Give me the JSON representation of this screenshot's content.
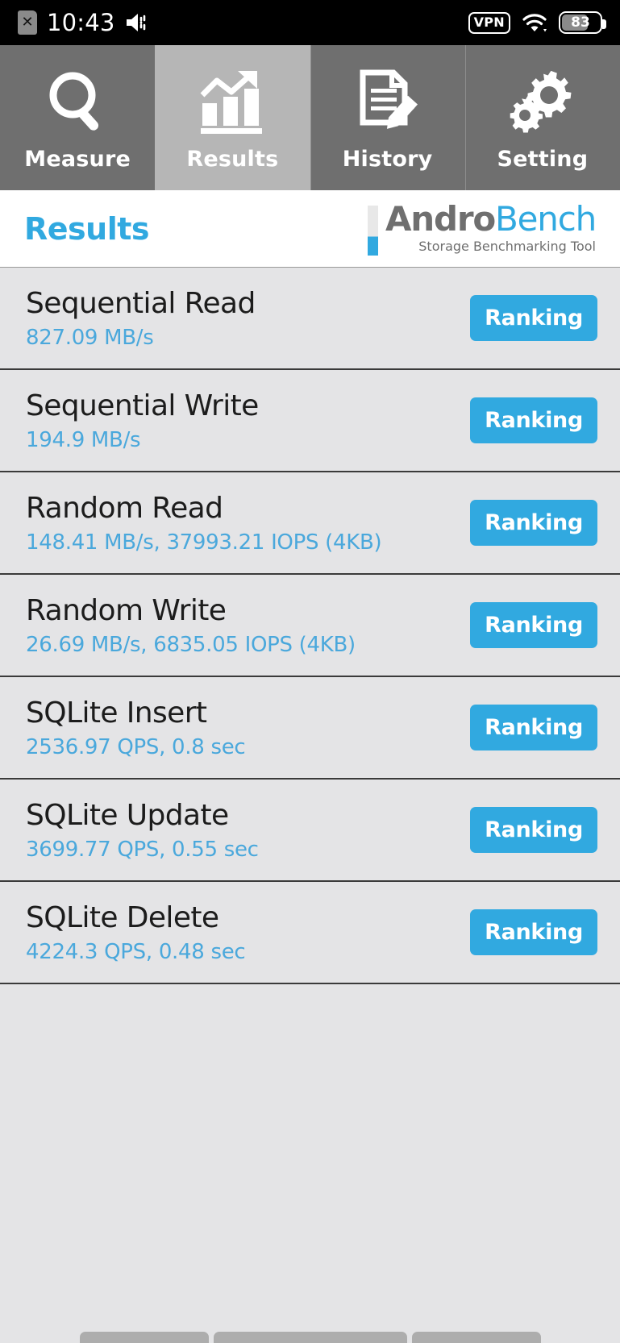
{
  "statusbar": {
    "sim_icon": "sim-card-off-icon",
    "time": "10:43",
    "volume_icon": "volume-icon",
    "vpn_label": "VPN",
    "wifi_icon": "wifi-icon",
    "battery_level": "83"
  },
  "tabs": [
    {
      "label": "Measure",
      "icon": "magnifier-icon",
      "active": false
    },
    {
      "label": "Results",
      "icon": "bar-chart-arrow-icon",
      "active": true
    },
    {
      "label": "History",
      "icon": "document-pencil-icon",
      "active": false
    },
    {
      "label": "Setting",
      "icon": "gears-icon",
      "active": false
    }
  ],
  "header": {
    "page_title": "Results",
    "brand_first": "Andro",
    "brand_second": "Bench",
    "brand_subtitle": "Storage Benchmarking Tool"
  },
  "results": [
    {
      "title": "Sequential Read",
      "value": "827.09 MB/s",
      "button": "Ranking"
    },
    {
      "title": "Sequential Write",
      "value": "194.9 MB/s",
      "button": "Ranking"
    },
    {
      "title": "Random Read",
      "value": "148.41 MB/s, 37993.21 IOPS (4KB)",
      "button": "Ranking"
    },
    {
      "title": "Random Write",
      "value": "26.69 MB/s, 6835.05 IOPS (4KB)",
      "button": "Ranking"
    },
    {
      "title": "SQLite Insert",
      "value": "2536.97 QPS, 0.8 sec",
      "button": "Ranking"
    },
    {
      "title": "SQLite Update",
      "value": "3699.77 QPS, 0.55 sec",
      "button": "Ranking"
    },
    {
      "title": "SQLite Delete",
      "value": "4224.3 QPS, 0.48 sec",
      "button": "Ranking"
    }
  ],
  "colors": {
    "accent_blue": "#31a9e0",
    "value_blue": "#4aa8dc",
    "tab_inactive": "#6f6f6f",
    "tab_active": "#b6b6b6",
    "list_bg": "#e4e4e6",
    "divider": "#3a3a3a"
  },
  "navbar": {
    "segments": 3
  }
}
